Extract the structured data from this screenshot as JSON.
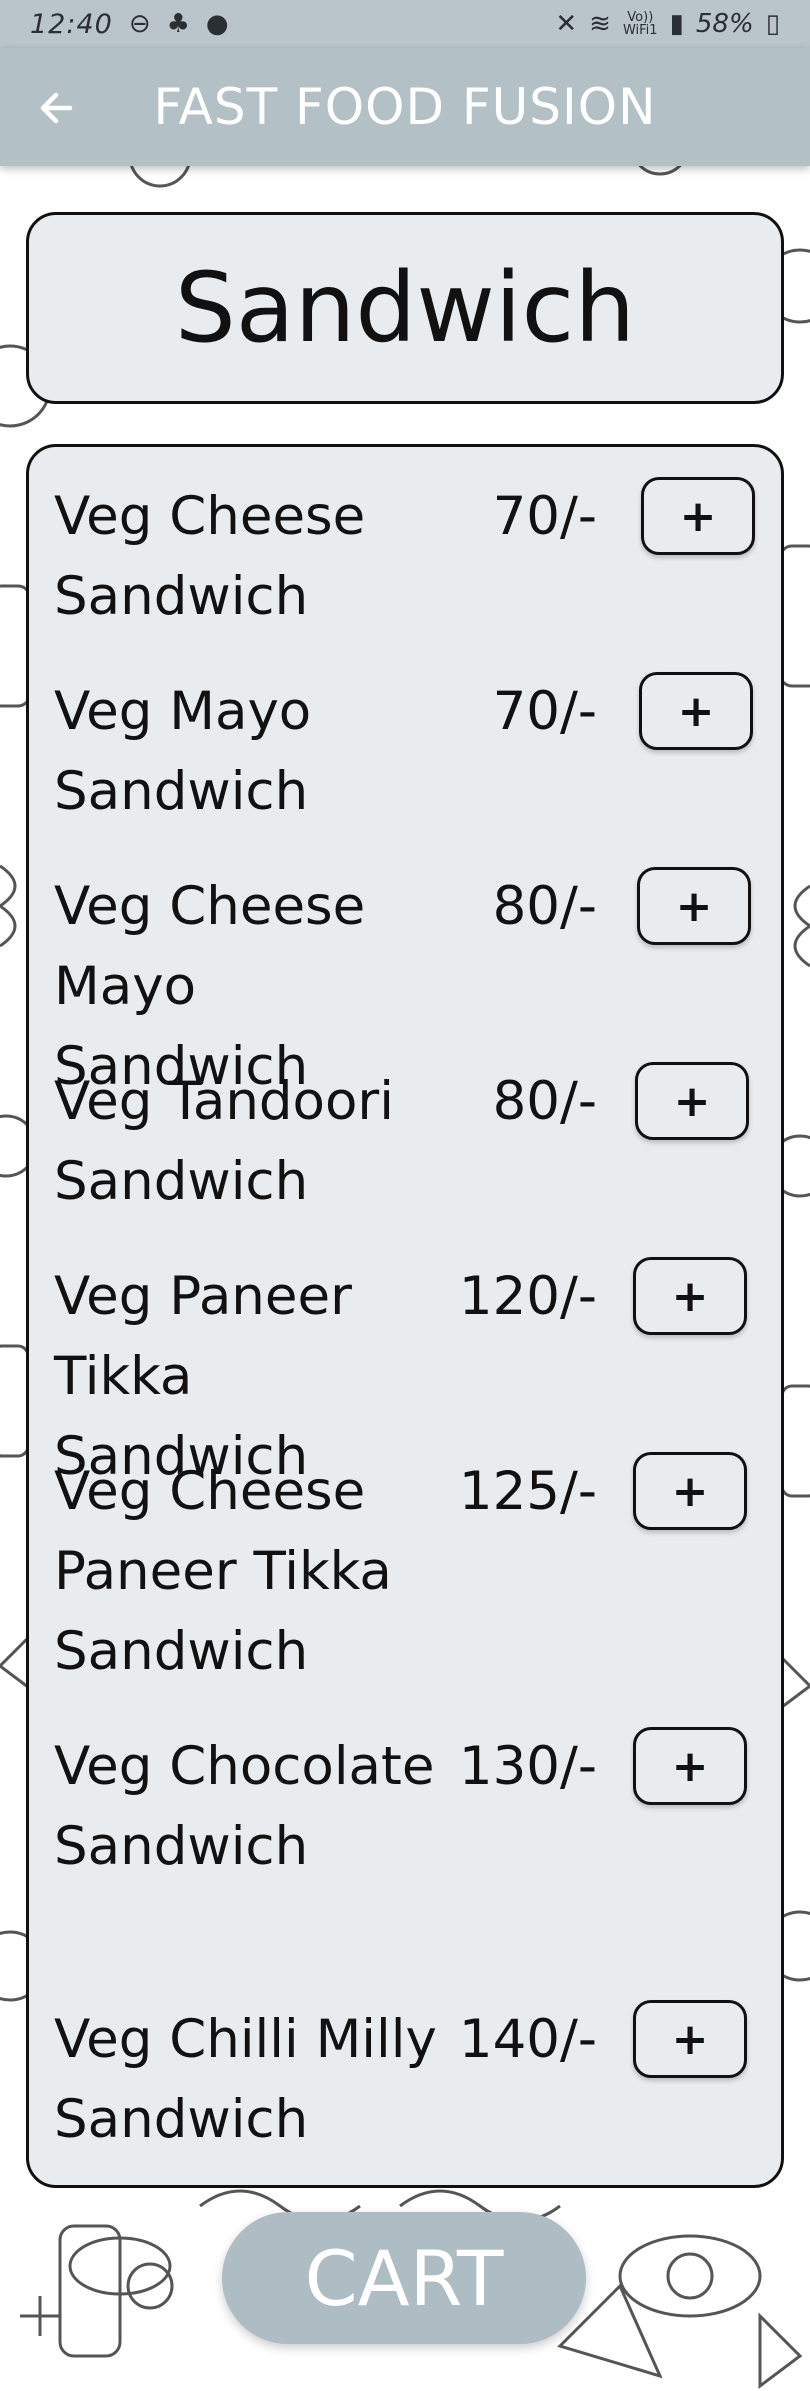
{
  "status_bar": {
    "time": "12:40",
    "network_label": "Vo))\nWiFi1",
    "battery": "58%",
    "icons": [
      "do-not-disturb-icon",
      "notification-icon",
      "spotify-icon",
      "mute-icon",
      "wifi-icon",
      "signal-icon",
      "battery-icon"
    ]
  },
  "app_bar": {
    "title": "FAST FOOD FUSION",
    "back_icon": "arrow-left-icon"
  },
  "category": {
    "title": "Sandwich"
  },
  "menu": {
    "items": [
      {
        "name": "Veg Cheese Sandwich",
        "price": "70/-",
        "button": "+"
      },
      {
        "name": "Veg Mayo Sandwich",
        "price": "70/-",
        "button": "+"
      },
      {
        "name": "Veg Cheese Mayo Sandwich",
        "price": "80/-",
        "button": "+"
      },
      {
        "name": "Veg Tandoori Sandwich",
        "price": "80/-",
        "button": "+"
      },
      {
        "name": "Veg Paneer Tikka Sandwich",
        "price": "120/-",
        "button": "+"
      },
      {
        "name": "Veg Cheese Paneer Tikka Sandwich",
        "price": "125/-",
        "button": "+"
      },
      {
        "name": "Veg Chocolate Sandwich",
        "price": "130/-",
        "button": "+"
      },
      {
        "name": "Veg Chilli Milly Sandwich",
        "price": "140/-",
        "button": "+"
      }
    ]
  },
  "cart": {
    "label": "CART"
  },
  "colors": {
    "app_bar": "#b3c1c7",
    "card_bg": "#e8ecef",
    "cart_bg": "#aebcc3",
    "text": "#111111"
  }
}
